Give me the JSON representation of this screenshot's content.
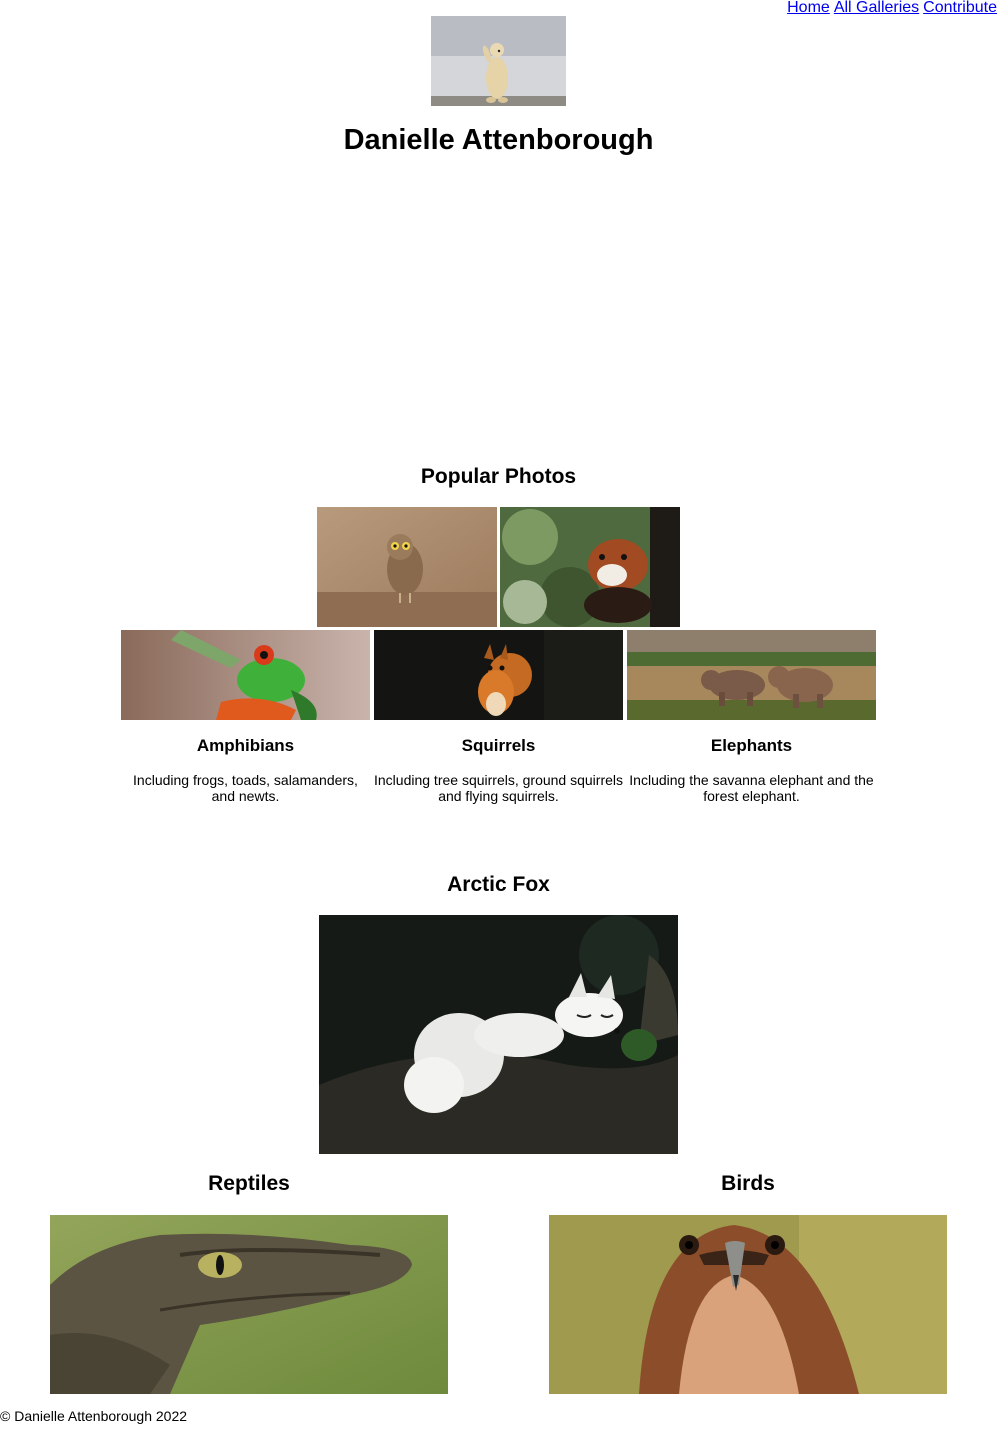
{
  "nav": {
    "home": "Home",
    "all_galleries": "All Galleries",
    "contribute": "Contribute"
  },
  "header": {
    "title": "Danielle Attenborough",
    "image_icon": "polar-bear-photo"
  },
  "popular": {
    "heading": "Popular Photos",
    "photos": [
      "owl-photo",
      "red-panda-photo"
    ]
  },
  "categories": [
    {
      "title": "Amphibians",
      "description": "Including frogs, toads, salamanders, and newts.",
      "image_icon": "tree-frog-photo"
    },
    {
      "title": "Squirrels",
      "description": "Including tree squirrels, ground squirrels and flying squirrels.",
      "image_icon": "squirrel-photo"
    },
    {
      "title": "Elephants",
      "description": "Including the savanna elephant and the forest elephant.",
      "image_icon": "elephants-photo"
    }
  ],
  "featured": {
    "title": "Arctic Fox",
    "image_icon": "arctic-fox-photo"
  },
  "bottom": [
    {
      "title": "Reptiles",
      "image_icon": "caiman-photo"
    },
    {
      "title": "Birds",
      "image_icon": "hawk-photo"
    }
  ],
  "footer": {
    "text": "© Danielle Attenborough 2022"
  }
}
